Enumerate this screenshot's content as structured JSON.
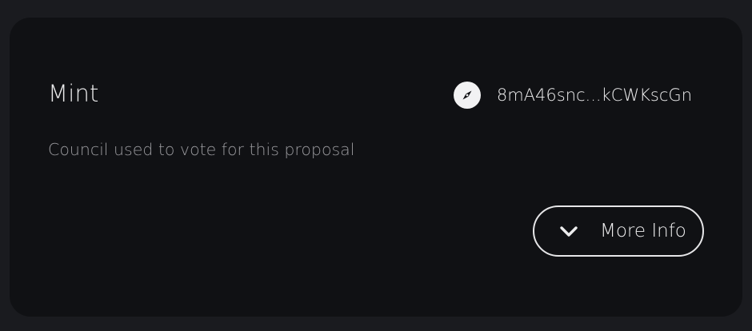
{
  "card": {
    "title": "Mint",
    "description": "Council used to vote for this proposal",
    "address": {
      "icon": "compass-icon",
      "text": "8mA46snc...kCWKscGn"
    },
    "more_info": {
      "icon": "chevron-down-icon",
      "label": "More Info"
    }
  },
  "colors": {
    "page_background": "#1a1b1f",
    "card_background": "#101114",
    "primary_text": "#e9e9ea",
    "secondary_text": "#9a9a9e"
  }
}
